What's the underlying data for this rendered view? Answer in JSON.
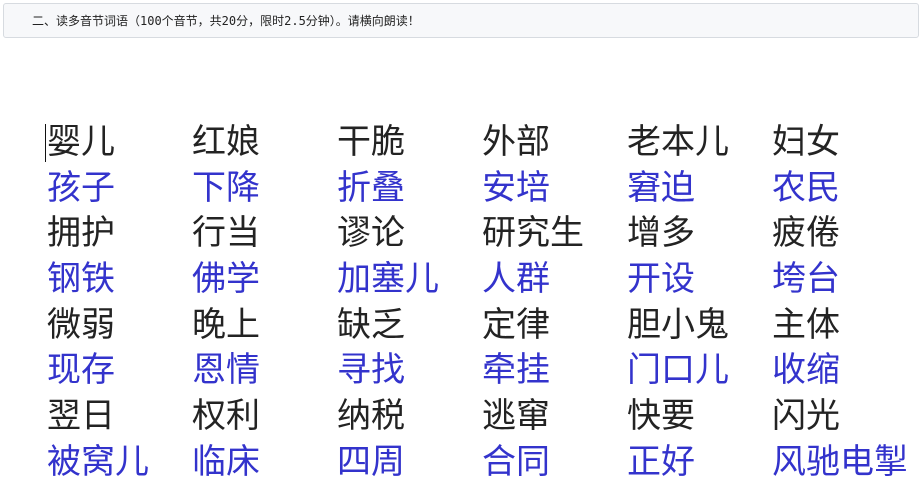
{
  "instruction": "二、读多音节词语（100个音节，共20分，限时2.5分钟）。请横向朗读！",
  "rows": [
    {
      "words": [
        "婴儿",
        "红娘",
        "干脆",
        "外部",
        "老本儿",
        "妇女"
      ]
    },
    {
      "words": [
        "孩子",
        "下降",
        "折叠",
        "安培",
        "窘迫",
        "农民"
      ]
    },
    {
      "words": [
        "拥护",
        "行当",
        "谬论",
        "研究生",
        "增多",
        "疲倦"
      ]
    },
    {
      "words": [
        "钢铁",
        "佛学",
        "加塞儿",
        "人群",
        "开设",
        "垮台"
      ]
    },
    {
      "words": [
        "微弱",
        "晚上",
        "缺乏",
        "定律",
        "胆小鬼",
        "主体"
      ]
    },
    {
      "words": [
        "现存",
        "恩情",
        "寻找",
        "牵挂",
        "门口儿",
        "收缩"
      ]
    },
    {
      "words": [
        "翌日",
        "权利",
        "纳税",
        "逃窜",
        "快要",
        "闪光"
      ]
    },
    {
      "words": [
        "被窝儿",
        "临床",
        "四周",
        "合同",
        "正好",
        "风驰电掣"
      ]
    }
  ],
  "colors": {
    "odd_row_text": "#232323",
    "even_row_text": "#3333cc",
    "instruction_bar_bg": "#f7f8fa"
  }
}
